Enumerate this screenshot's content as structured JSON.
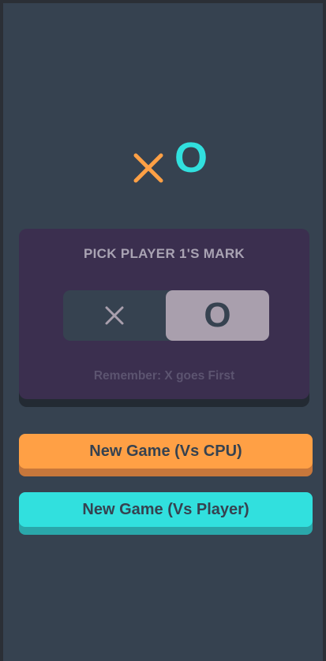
{
  "logo": {
    "x_mark_icon": "x-mark-icon",
    "o_mark": "O",
    "x_color": "#ffa045",
    "o_color": "#31e0de"
  },
  "card": {
    "title": "PICK PLAYER 1'S MARK",
    "toggle": {
      "x_icon": "x-mark-icon",
      "o_label": "O",
      "selected": "O"
    },
    "note": "Remember: X goes First"
  },
  "buttons": {
    "vs_cpu": "New Game (Vs CPU)",
    "vs_player": "New Game (Vs Player)"
  },
  "colors": {
    "background": "#364250",
    "card": "#3b2f4f",
    "accent_orange": "#ffa045",
    "accent_teal": "#31e0de",
    "selected_toggle": "#a99fad"
  }
}
